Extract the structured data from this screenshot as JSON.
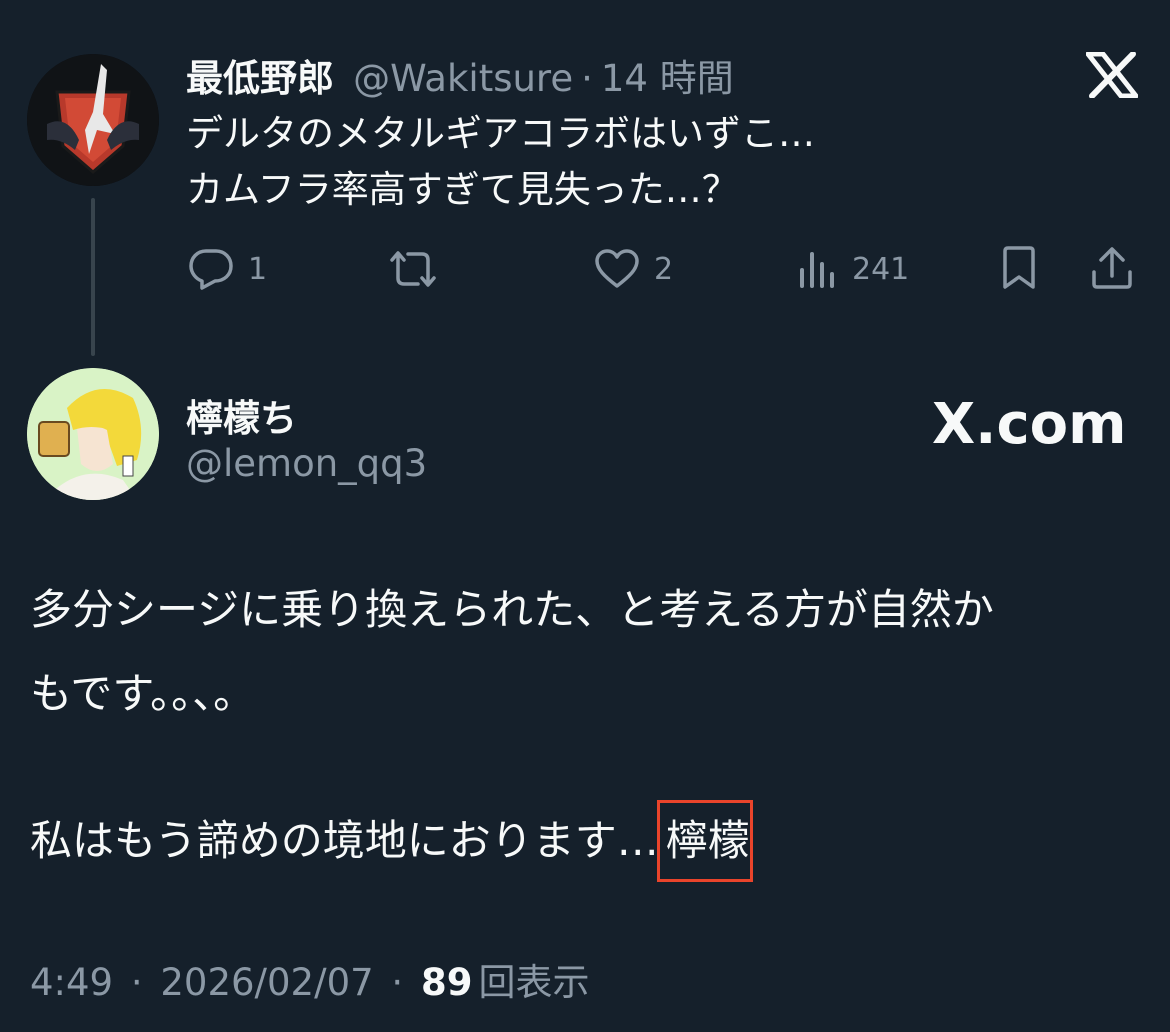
{
  "parent_tweet": {
    "display_name": "最低野郎",
    "handle": "@Wakitsure",
    "separator": "·",
    "time_ago": "14 時間",
    "text_line1": "デルタのメタルギアコラボはいずこ…",
    "text_line2": "カムフラ率高すぎて見失った…？",
    "actions": {
      "reply_count": "1",
      "like_count": "2",
      "view_count": "241"
    }
  },
  "reply_tweet": {
    "display_name": "檸檬ち",
    "handle": "@lemon_qq3",
    "brand_text": "X.com",
    "text_line1": "多分シージに乗り換えられた、と考える方が自然か",
    "text_line2": "もです。。、。",
    "text_line3_main": "私はもう諦めの境地におります…",
    "text_line3_highlight": "檸檬",
    "meta_time": "4:49",
    "meta_sep": "·",
    "meta_date": "2026/02/07",
    "meta_views_count": "89",
    "meta_views_label": "回表示"
  },
  "icons": {
    "close": "x-logo-icon",
    "reply": "reply-bubble-icon",
    "repost": "repost-icon",
    "like": "heart-icon",
    "views": "bar-chart-icon",
    "bookmark": "bookmark-icon",
    "share": "share-icon"
  },
  "colors": {
    "background": "#15202b",
    "text": "#f7f9f9",
    "secondary": "#8b98a5",
    "highlight_border": "#e9442b"
  }
}
